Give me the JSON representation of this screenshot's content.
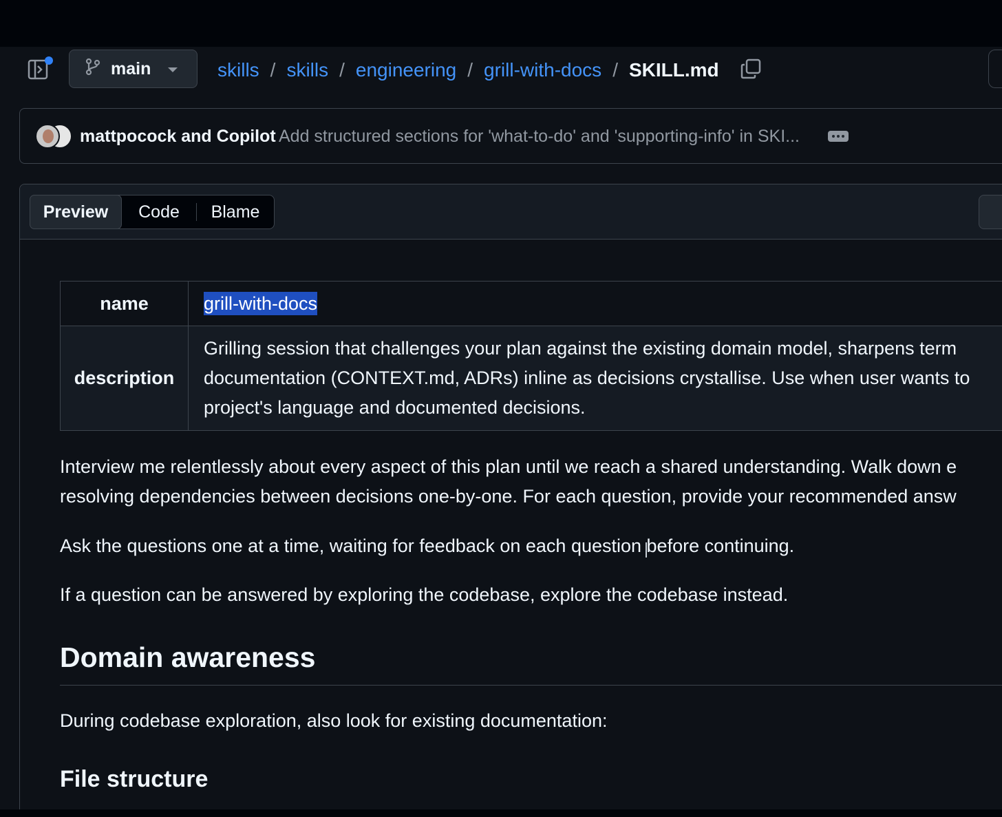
{
  "repo_header": {
    "branch": "main",
    "breadcrumb": [
      "skills",
      "skills",
      "engineering",
      "grill-with-docs"
    ],
    "separator": "/",
    "current_file": "SKILL.md"
  },
  "commit": {
    "authors_bold": "mattpocock and Copilot",
    "message": "Add structured sections for 'what-to-do' and 'supporting-info' in SKI..."
  },
  "view_tabs": {
    "preview": "Preview",
    "code": "Code",
    "blame": "Blame",
    "active": "Preview"
  },
  "frontmatter": {
    "name_key": "name",
    "name_value": "grill-with-docs",
    "description_key": "description",
    "description_lines": [
      "Grilling session that challenges your plan against the existing domain model, sharpens term",
      "documentation (CONTEXT.md, ADRs) inline as decisions crystallise. Use when user wants to",
      "project's language and documented decisions."
    ]
  },
  "content": {
    "para1_lines": [
      "Interview me relentlessly about every aspect of this plan until we reach a shared understanding. Walk down e",
      "resolving dependencies between decisions one-by-one. For each question, provide your recommended answ"
    ],
    "para2": "Ask the questions one at a time, waiting for feedback on each question before continuing.",
    "para3": "If a question can be answered by exploring the codebase, explore the codebase instead.",
    "heading_domain": "Domain awareness",
    "para4": "During codebase exploration, also look for existing documentation:",
    "heading_file_structure": "File structure"
  },
  "colors": {
    "background": "#0d1117",
    "link": "#4493f8",
    "selection": "#1f4fc0",
    "muted": "#9198a1",
    "border": "#3d444d"
  },
  "icons": [
    "sidebar-toggle-icon",
    "git-branch-icon",
    "chevron-down-icon",
    "copy-icon",
    "ellipsis-icon",
    "avatar"
  ]
}
